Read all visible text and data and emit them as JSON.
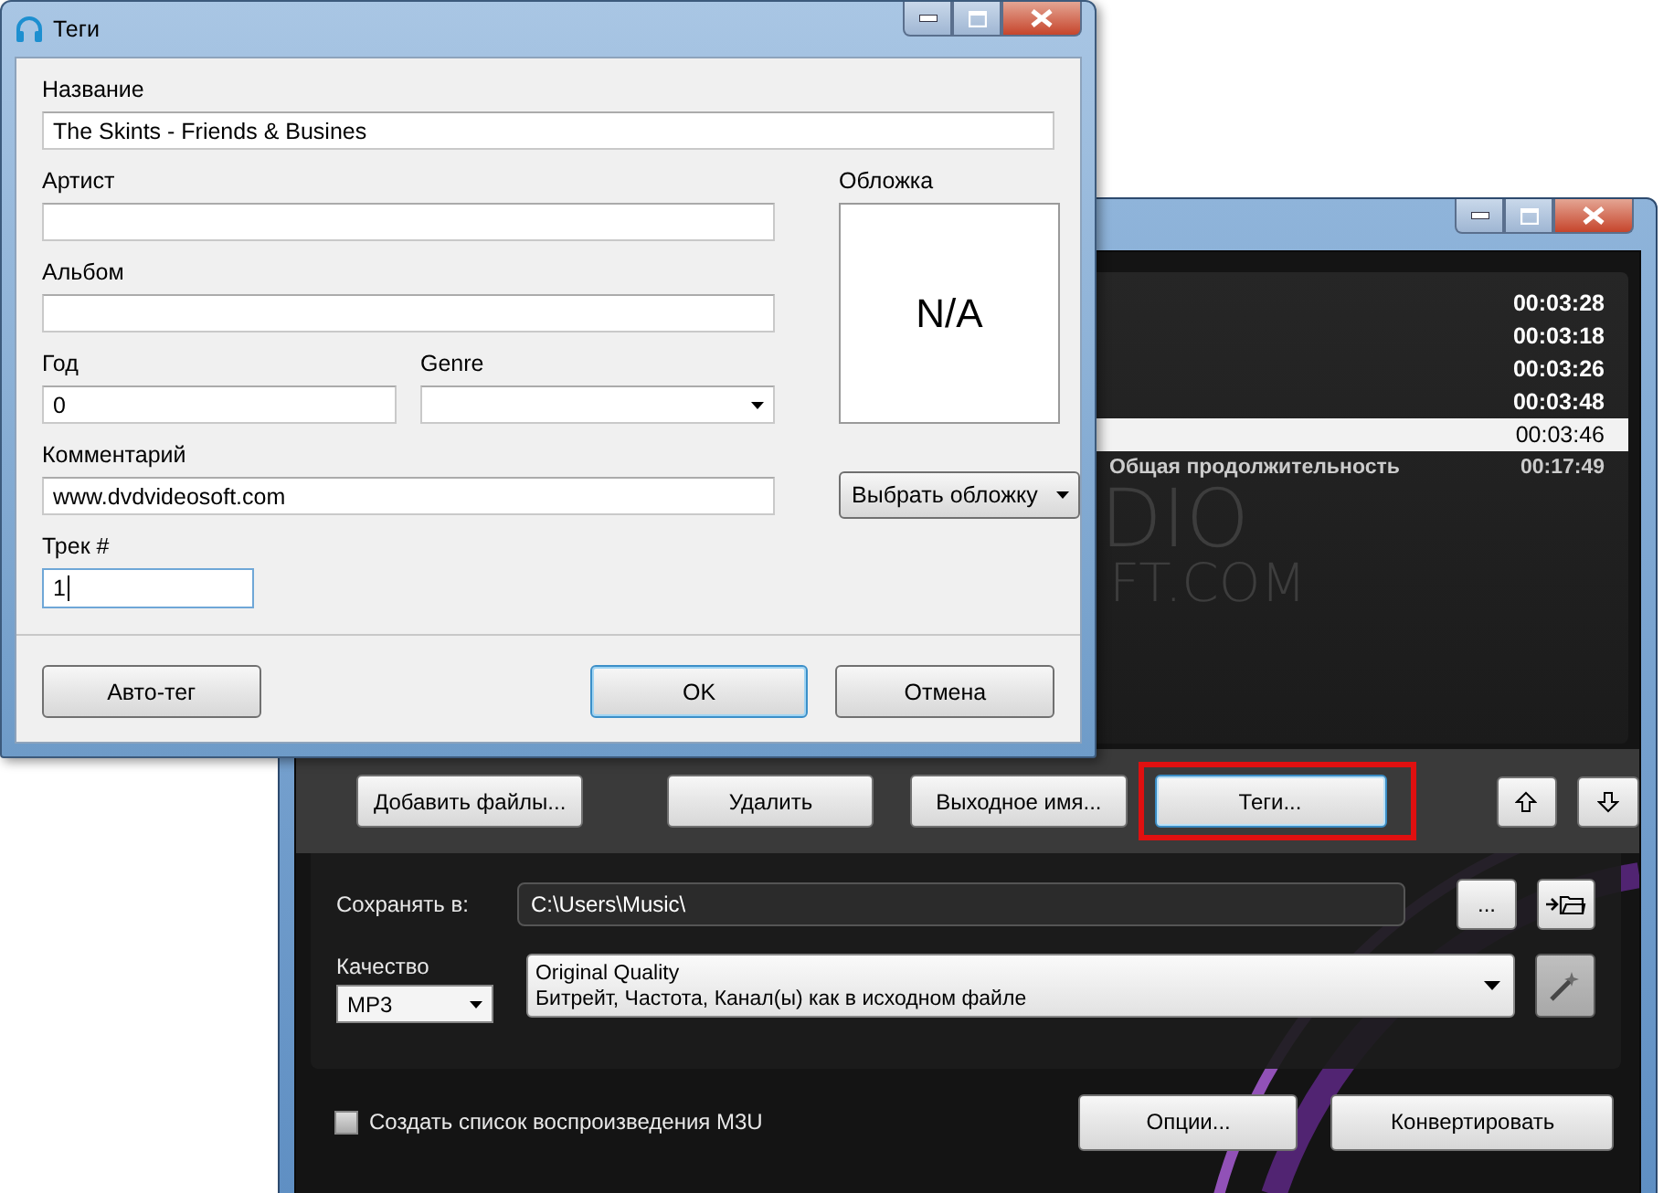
{
  "tags_dialog": {
    "title": "Теги",
    "name_field": {
      "label": "Название",
      "value": "The Skints - Friends & Busines"
    },
    "artist_field": {
      "label": "Артист"
    },
    "album_field": {
      "label": "Альбом"
    },
    "year_field": {
      "label": "Год",
      "value": "0"
    },
    "genre_field": {
      "label": "Genre"
    },
    "comment_field": {
      "label": "Комментарий",
      "value": "www.dvdvideosoft.com"
    },
    "track_field": {
      "label": "Трек #",
      "value": "1",
      "focused": true
    },
    "cover": {
      "label": "Обложка",
      "text": "N/A"
    },
    "choose_cover_button": "Выбрать обложку",
    "buttons": [
      {
        "label": "Авто-тег",
        "default": false
      },
      {
        "label": "OK",
        "default": true
      },
      {
        "label": "Отмена",
        "default": false
      }
    ]
  },
  "main_window": {
    "track_durations": [
      {
        "duration": "00:03:28",
        "selected": false
      },
      {
        "duration": "00:03:18",
        "selected": false
      },
      {
        "duration": "00:03:26",
        "selected": false
      },
      {
        "duration": "00:03:48",
        "selected": false
      },
      {
        "duration": "00:03:46",
        "selected": true
      }
    ],
    "total": {
      "label": "Общая продолжительность",
      "value": "00:17:49"
    },
    "logo_text": [
      "DIO",
      "FT.COM"
    ],
    "action_buttons": [
      {
        "label": "Добавить файлы...",
        "highlighted": false
      },
      {
        "label": "Удалить",
        "highlighted": false
      },
      {
        "label": "Выходное имя...",
        "highlighted": false
      },
      {
        "label": "Теги...",
        "highlighted": true
      }
    ],
    "save_to": {
      "label": "Сохранять в:",
      "value": "C:\\Users\\Music\\",
      "browse_button": "..."
    },
    "quality": {
      "label": "Качество",
      "format": "MP3",
      "preset_title": "Original Quality",
      "preset_description": "Битрейт, Частота, Канал(ы) как в исходном файле"
    },
    "playlist_checkbox": {
      "label": "Создать список воспроизведения M3U",
      "checked": false
    },
    "bottom_buttons": [
      "Опции...",
      "Конвертировать"
    ]
  }
}
